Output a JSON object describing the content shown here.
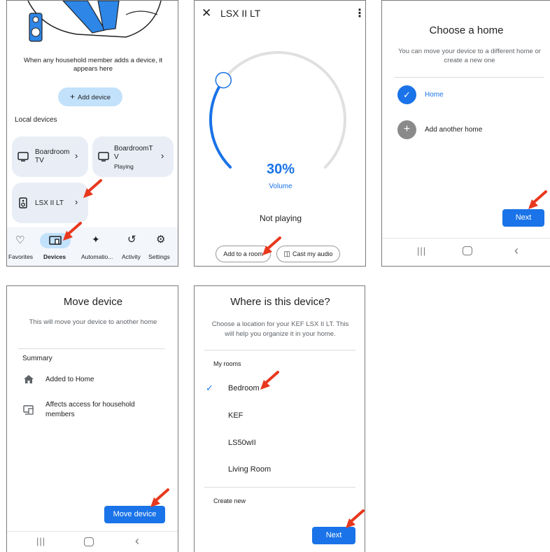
{
  "panel1": {
    "empty_text": "When any household member adds a device, it appears here",
    "add_device_label": "Add device",
    "section_label": "Local devices",
    "devices": [
      {
        "name_line1": "Boardroom",
        "name_line2": "TV",
        "status": ""
      },
      {
        "name_line1": "BoardroomT",
        "name_line2": "V",
        "status": "Playing"
      },
      {
        "name_line1": "LSX II LT",
        "name_line2": "",
        "status": ""
      }
    ],
    "nav": [
      {
        "label": "Favorites",
        "icon": "heart-icon"
      },
      {
        "label": "Devices",
        "icon": "devices-icon"
      },
      {
        "label": "Automatio...",
        "icon": "sparkle-icon"
      },
      {
        "label": "Activity",
        "icon": "history-icon"
      },
      {
        "label": "Settings",
        "icon": "gear-icon"
      }
    ],
    "active_nav": "Devices"
  },
  "panel2": {
    "title": "LSX II LT",
    "volume_value": "30%",
    "volume_label": "Volume",
    "volume_level": 0.3,
    "status": "Not playing",
    "add_room_label": "Add to a room",
    "cast_label": "Cast my audio"
  },
  "panel3": {
    "title": "Choose a home",
    "subtitle": "You can move your device to a different home or create a new one",
    "home_label": "Home",
    "add_home_label": "Add another home",
    "next_label": "Next"
  },
  "panel4": {
    "title": "Move device",
    "subtitle": "This will move your device to another home",
    "summary_label": "Summary",
    "item1": "Added to Home",
    "item2_line1": "Affects access for household",
    "item2_line2": "members",
    "button_label": "Move device"
  },
  "panel5": {
    "title": "Where is this device?",
    "subtitle_line1": "Choose a location for your KEF LSX II LT. This",
    "subtitle_line2": "will help you organize it in your home.",
    "rooms_label": "My rooms",
    "rooms": [
      "Bedroom",
      "KEF",
      "LS50wII",
      "Living Room"
    ],
    "selected_room": "Bedroom",
    "create_label": "Create new",
    "next_label": "Next"
  },
  "colors": {
    "accent": "#1a73e8",
    "annotation_arrow": "#e8381e",
    "tile_bg": "#e9eef6",
    "chip_bg": "#c2e1fb"
  }
}
